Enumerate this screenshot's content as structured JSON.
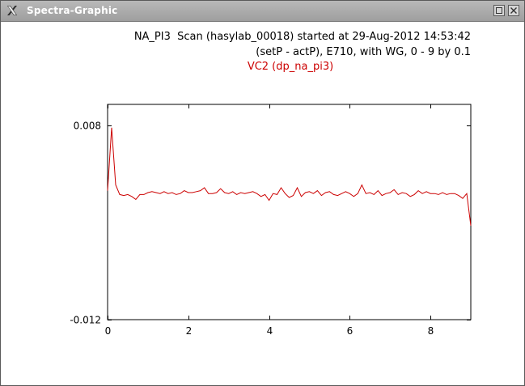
{
  "window": {
    "title": "Spectra-Graphic",
    "buttons": {
      "minimize_icon": "minimize-icon",
      "close_icon": "close-icon"
    }
  },
  "header": {
    "line1": "NA_PI3  Scan (hasylab_00018) started at 29-Aug-2012 14:53:42",
    "line2": "(setP - actP), E710, with WG, 0 - 9 by 0.1"
  },
  "colors": {
    "trace": "#cc0000",
    "title": "#cc0000",
    "axis": "#000000"
  },
  "chart_data": {
    "type": "line",
    "title": "VC2 (dp_na_pi3)",
    "xlabel": "",
    "ylabel": "",
    "xlim": [
      0,
      9
    ],
    "ylim": [
      -0.012,
      0.0102
    ],
    "x_ticks": [
      0,
      2,
      4,
      6,
      8
    ],
    "x_tick_labels": [
      "0",
      "2",
      "4",
      "6",
      "8"
    ],
    "y_ticks": [
      0.008,
      -0.012
    ],
    "y_tick_labels": [
      "0.008",
      "-0.012"
    ],
    "grid": false,
    "series": [
      {
        "x": [
          0,
          0.1,
          0.2,
          0.3,
          0.4,
          0.5,
          0.6,
          0.7,
          0.8,
          0.9,
          1.0,
          1.1,
          1.2,
          1.3,
          1.4,
          1.5,
          1.6,
          1.7,
          1.8,
          1.9,
          2.0,
          2.1,
          2.2,
          2.3,
          2.4,
          2.5,
          2.6,
          2.7,
          2.8,
          2.9,
          3.0,
          3.1,
          3.2,
          3.3,
          3.4,
          3.5,
          3.6,
          3.7,
          3.8,
          3.9,
          4.0,
          4.1,
          4.2,
          4.3,
          4.4,
          4.5,
          4.6,
          4.7,
          4.8,
          4.9,
          5.0,
          5.1,
          5.2,
          5.3,
          5.4,
          5.5,
          5.6,
          5.7,
          5.8,
          5.9,
          6.0,
          6.1,
          6.2,
          6.3,
          6.4,
          6.5,
          6.6,
          6.7,
          6.8,
          6.9,
          7.0,
          7.1,
          7.2,
          7.3,
          7.4,
          7.5,
          7.6,
          7.7,
          7.8,
          7.9,
          8.0,
          8.1,
          8.2,
          8.3,
          8.4,
          8.5,
          8.6,
          8.7,
          8.8,
          8.9,
          9.0
        ],
        "y": [
          0.0013,
          0.0078,
          0.0019,
          0.0009,
          0.0008,
          0.0009,
          0.0007,
          0.0004,
          0.0009,
          0.0009,
          0.0011,
          0.0012,
          0.0011,
          0.001,
          0.0012,
          0.001,
          0.0011,
          0.0009,
          0.001,
          0.0013,
          0.0011,
          0.0011,
          0.0012,
          0.0013,
          0.0016,
          0.001,
          0.001,
          0.0011,
          0.0015,
          0.0011,
          0.001,
          0.0012,
          0.0009,
          0.0011,
          0.001,
          0.0011,
          0.0012,
          0.001,
          0.0007,
          0.0009,
          0.0003,
          0.001,
          0.0009,
          0.0016,
          0.001,
          0.0006,
          0.0008,
          0.0016,
          0.0007,
          0.0011,
          0.0012,
          0.001,
          0.0013,
          0.0008,
          0.0011,
          0.0012,
          0.0009,
          0.0008,
          0.001,
          0.0012,
          0.001,
          0.0007,
          0.001,
          0.0019,
          0.001,
          0.0011,
          0.0009,
          0.0013,
          0.0008,
          0.001,
          0.0011,
          0.0014,
          0.0009,
          0.0011,
          0.001,
          0.0007,
          0.0009,
          0.0013,
          0.001,
          0.0012,
          0.001,
          0.001,
          0.0009,
          0.0011,
          0.0009,
          0.001,
          0.001,
          0.0008,
          0.0005,
          0.001,
          -0.0023
        ]
      }
    ]
  }
}
